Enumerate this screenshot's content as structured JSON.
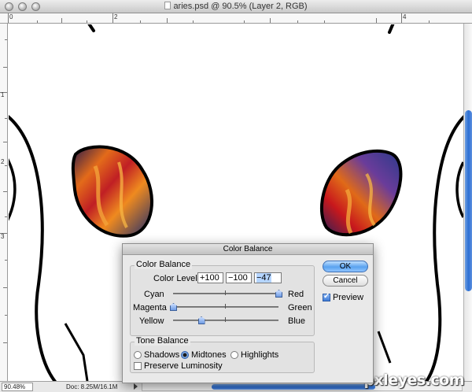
{
  "window": {
    "title": "aries.psd @ 90.5% (Layer 2, RGB)"
  },
  "rulers": {
    "top_numbers": [
      "0",
      "2",
      "4"
    ],
    "left_numbers": [
      "1",
      "2",
      "3"
    ]
  },
  "status_bar": {
    "zoom": "90.48%",
    "doc_info": "Doc: 8.25M/16.1M"
  },
  "watermark": "pxleyes.com",
  "dialog": {
    "title": "Color Balance",
    "color_balance_group": {
      "label": "Color Balance",
      "levels_label": "Color Levels:",
      "levels": [
        "+100",
        "−100",
        "−47"
      ],
      "sliders": [
        {
          "left": "Cyan",
          "right": "Red",
          "value": 100
        },
        {
          "left": "Magenta",
          "right": "Green",
          "value": -100
        },
        {
          "left": "Yellow",
          "right": "Blue",
          "value": -47
        }
      ]
    },
    "tone_balance_group": {
      "label": "Tone Balance",
      "options": [
        "Shadows",
        "Midtones",
        "Highlights"
      ],
      "selected": "Midtones",
      "preserve_luminosity_label": "Preserve Luminosity",
      "preserve_luminosity": false
    },
    "buttons": {
      "ok": "OK",
      "cancel": "Cancel"
    },
    "preview_label": "Preview",
    "preview_checked": true
  },
  "colors": {
    "accent_blue": "#3d7ad6",
    "stroke": "#000000"
  }
}
